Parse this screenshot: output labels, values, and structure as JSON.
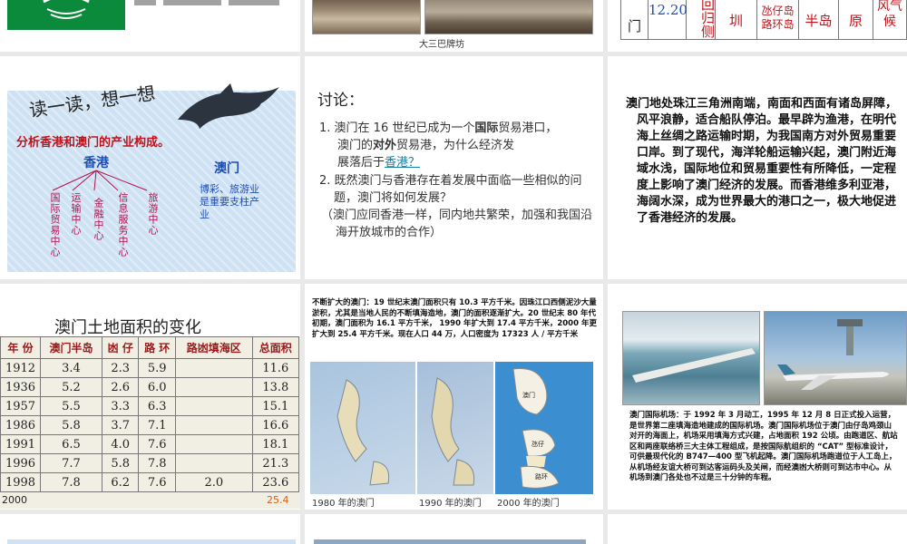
{
  "slide1": {},
  "slide2": {
    "caption": "大三巴牌坊"
  },
  "slide3": {
    "cells": [
      "门",
      "12.20",
      "回归侧",
      "圳",
      "氹仔岛路环岛",
      "半岛",
      "原",
      "风气候"
    ]
  },
  "slide4": {
    "title": "读一读，想一想",
    "subtitle": "分析香港和澳门的产业构成。",
    "hk_label": "香港",
    "hk_items": [
      "国际贸易中心",
      "运输中心",
      "金融中心",
      "信息服务中心",
      "旅游中心"
    ],
    "mo_label": "澳门",
    "mo_text": "博彩、旅游业是重要支柱产业"
  },
  "slide5": {
    "heading": "讨论：",
    "q1_num": "1.",
    "q1_text_a": "澳门在 16 世纪已成为一个",
    "q1_overlay_a": "国际",
    "q1_text_b": "贸易港口，",
    "q1_line2": "澳门的",
    "q1_overlay_b": "对外",
    "q1_line2_b": "贸易港，为什么经济发",
    "q1_line3": "展落后于",
    "q1_link": "香港？",
    "q2_num": "2.",
    "q2_text": "既然澳门与香港存在着发展中面临一些相似的问题，澳门将如何发展？",
    "answer": "（澳门应同香港一样，同内地共繁荣，加强和我国沿海开放城市的合作）"
  },
  "slide6": {
    "paragraph": "澳门地处珠江三角洲南端，南面和西面有诸岛屏障，风平浪静，适合船队停泊。最早辟为渔港，在明代海上丝绸之路运输时期，为我国南方对外贸易重要口岸。到了现代，海洋轮船运输兴起，澳门附近海域水浅，国际地位和贸易重要性有所降低，一定程度上影响了澳门经济的发展。而香港维多利亚港，海阔水深，成为世界最大的港口之一，极大地促进了香港经济的发展。"
  },
  "slide7": {
    "title": "澳门土地面积的变化",
    "headers": [
      "年 份",
      "澳门半岛",
      "凼 仔",
      "路 环",
      "路凼填海区",
      "总面积"
    ],
    "rows": [
      [
        "1912",
        "3.4",
        "2.3",
        "5.9",
        "",
        "11.6"
      ],
      [
        "1936",
        "5.2",
        "2.6",
        "6.0",
        "",
        "13.8"
      ],
      [
        "1957",
        "5.5",
        "3.3",
        "6.3",
        "",
        "15.1"
      ],
      [
        "1986",
        "5.8",
        "3.7",
        "7.1",
        "",
        "16.6"
      ],
      [
        "1991",
        "6.5",
        "4.0",
        "7.6",
        "",
        "18.1"
      ],
      [
        "1996",
        "7.7",
        "5.8",
        "7.8",
        "",
        "21.3"
      ],
      [
        "1998",
        "7.8",
        "6.2",
        "7.6",
        "2.0",
        "23.6"
      ]
    ],
    "extra_year": "2000",
    "extra_total": "25.4"
  },
  "slide8": {
    "lead": "不断扩大的澳门：",
    "text": "19 世纪末澳门面积只有 10.3 平方千米。因珠江口西侧泥沙大量淤积，尤其是当地人民的不断填海造地，澳门的面积逐渐扩大。20 世纪末 80 年代初期，澳门面积为 16.1 平方千米， 1990 年扩大到 17.4 平方千米，2000 年更扩大到 25.4 平方千米。现在人口 44 万，人口密度为 17323 人 / 平方千米",
    "captions": [
      "1980 年的澳门",
      "1990 年的澳门",
      "2000 年的澳门"
    ],
    "map_labels": [
      "澳门",
      "氹仔",
      "路环"
    ]
  },
  "slide9": {
    "text": "澳门国际机场：于 1992 年 3 月动工，1995 年 12 月 8 日正式投入运营，是世界第二座填海造地建成的国际机场。澳门国际机场位于澳门由仔岛鸡颈山对开的海面上，机场采用填海方式兴建，占地面积 192 公顷。由跑道区、航站区和两座联络桥三大主体工程组成，是按国际航组织的 “CAT” 型标准设计，可供最现代化的 B747—400 型飞机起降。澳门国际机场跑道位于人工岛上，从机场经友谊大桥可到达客运码头及关闸，而经澳凼大桥则可到达市中心。从机场到澳门各处也不过是三十分钟的车程。"
  },
  "colors": {
    "slide4_bg": "#cfe2f3",
    "accent_red": "#c0121a",
    "hk_blue": "#1f4fb4",
    "flag_green": "#0c8a3c"
  }
}
